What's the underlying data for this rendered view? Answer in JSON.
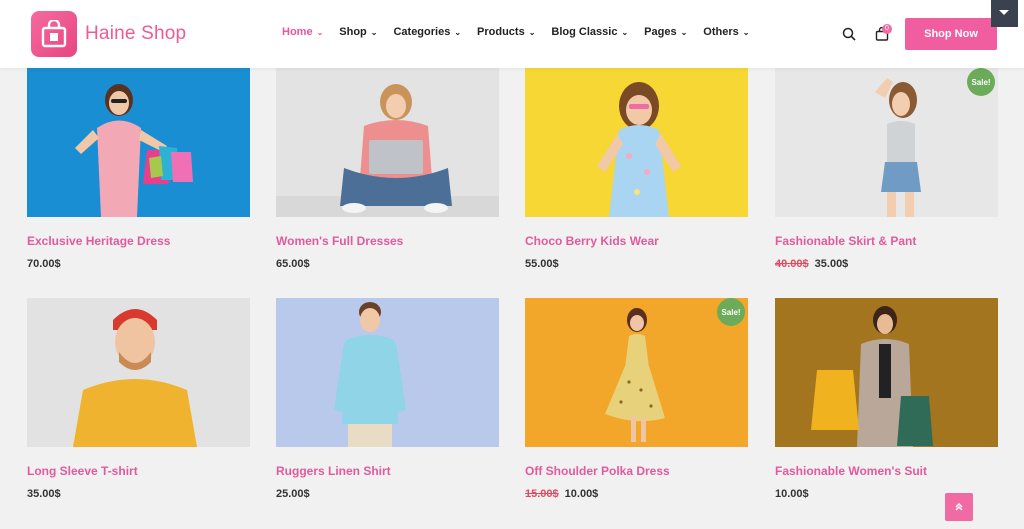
{
  "header": {
    "brand": "Haine Shop",
    "nav": [
      {
        "label": "Home",
        "active": true
      },
      {
        "label": "Shop"
      },
      {
        "label": "Categories"
      },
      {
        "label": "Products"
      },
      {
        "label": "Blog Classic"
      },
      {
        "label": "Pages"
      },
      {
        "label": "Others"
      }
    ],
    "cart_count": "0",
    "cta_label": "Shop Now"
  },
  "products": [
    {
      "title": "Exclusive Heritage Dress",
      "price": "70.00$"
    },
    {
      "title": "Women's Full Dresses",
      "price": "65.00$"
    },
    {
      "title": "Choco Berry Kids Wear",
      "price": "55.00$"
    },
    {
      "title": "Fashionable Skirt & Pant",
      "old_price": "40.00$",
      "price": "35.00$",
      "badge": "Sale!"
    },
    {
      "title": "Long Sleeve T-shirt",
      "price": "35.00$"
    },
    {
      "title": "Ruggers Linen Shirt",
      "price": "25.00$"
    },
    {
      "title": "Off Shoulder Polka Dress",
      "old_price": "15.00$",
      "price": "10.00$",
      "badge": "Sale!"
    },
    {
      "title": "Fashionable Women's Suit",
      "price": "10.00$"
    }
  ],
  "colors": {
    "accent": "#f05e9f",
    "title_pink": "#e25a9c",
    "sale_green": "#6bab5a",
    "old_price_red": "#e24a5f"
  },
  "icons": {
    "search": "search-icon",
    "cart": "shopping-bag-icon",
    "back_to_top": "double-chevron-up-icon",
    "corner_toggle": "caret-down-icon"
  }
}
